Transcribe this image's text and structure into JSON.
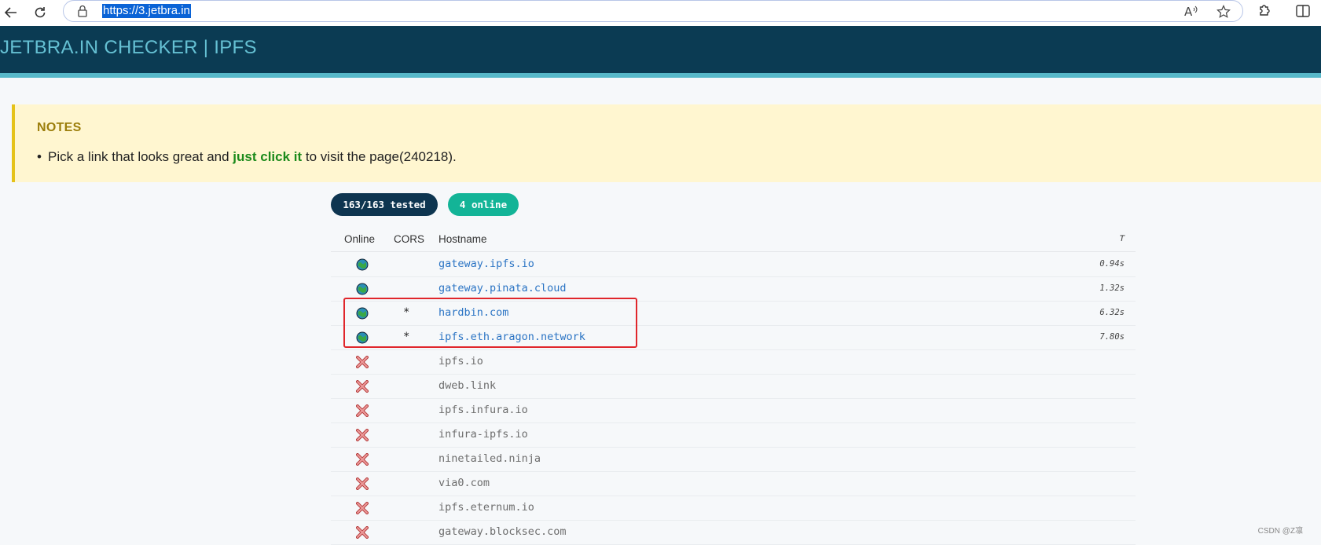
{
  "browser": {
    "url": "https://3.jetbra.in",
    "icons": [
      "back-icon",
      "refresh-icon",
      "lock-icon",
      "read-aloud-icon",
      "favorite-star-icon",
      "extensions-icon",
      "split-screen-icon"
    ]
  },
  "header": {
    "title": "JETBRA.IN CHECKER | IPFS"
  },
  "notes": {
    "title": "NOTES",
    "line_before": "Pick a link that looks great and ",
    "line_bold": "just click it",
    "line_after": " to visit the page(240218)."
  },
  "badges": {
    "tested": "163/163 tested",
    "online": "4 online"
  },
  "table": {
    "headers": {
      "online": "Online",
      "cors": "CORS",
      "hostname": "Hostname",
      "time": "T"
    },
    "rows": [
      {
        "status": "online",
        "cors": "",
        "hostname": "gateway.ipfs.io",
        "time": "0.94s"
      },
      {
        "status": "online",
        "cors": "",
        "hostname": "gateway.pinata.cloud",
        "time": "1.32s"
      },
      {
        "status": "online",
        "cors": "*",
        "hostname": "hardbin.com",
        "time": "6.32s"
      },
      {
        "status": "online",
        "cors": "*",
        "hostname": "ipfs.eth.aragon.network",
        "time": "7.80s"
      },
      {
        "status": "offline",
        "cors": "",
        "hostname": "ipfs.io",
        "time": ""
      },
      {
        "status": "offline",
        "cors": "",
        "hostname": "dweb.link",
        "time": ""
      },
      {
        "status": "offline",
        "cors": "",
        "hostname": "ipfs.infura.io",
        "time": ""
      },
      {
        "status": "offline",
        "cors": "",
        "hostname": "infura-ipfs.io",
        "time": ""
      },
      {
        "status": "offline",
        "cors": "",
        "hostname": "ninetailed.ninja",
        "time": ""
      },
      {
        "status": "offline",
        "cors": "",
        "hostname": "via0.com",
        "time": ""
      },
      {
        "status": "offline",
        "cors": "",
        "hostname": "ipfs.eternum.io",
        "time": ""
      },
      {
        "status": "offline",
        "cors": "",
        "hostname": "gateway.blocksec.com",
        "time": ""
      }
    ]
  },
  "colors": {
    "header_bg": "#0b3b53",
    "header_text": "#65c0d3",
    "header_accent": "#57b8c9",
    "online_green": "#13b497",
    "badge_dark": "#0e3550",
    "link_blue": "#2b74c4",
    "offline_red": "#e07070",
    "highlight_red": "#e0262b"
  },
  "watermark": "CSDN @Z凛"
}
